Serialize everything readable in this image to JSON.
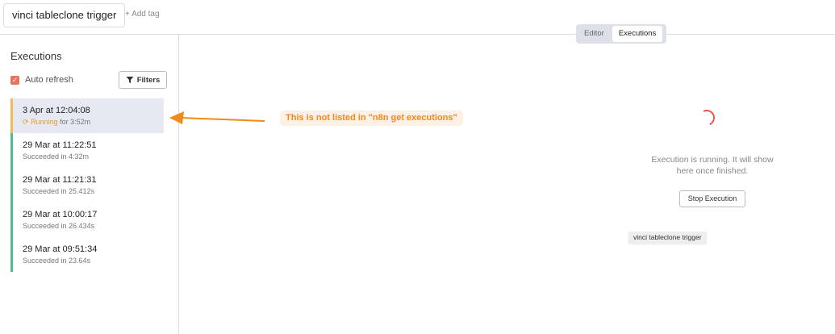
{
  "header": {
    "workflow_name": "vinci tableclone trigger",
    "add_tag": "+ Add tag",
    "tabs": [
      {
        "label": "Editor",
        "active": false
      },
      {
        "label": "Executions",
        "active": true
      }
    ]
  },
  "sidebar": {
    "title": "Executions",
    "auto_refresh": {
      "label": "Auto refresh",
      "checked": true
    },
    "filters_label": "Filters",
    "executions": [
      {
        "date": "3 Apr at 12:04:08",
        "status_word": "Running",
        "status_rest": " for 3:52m",
        "state": "running"
      },
      {
        "date": "29 Mar at 11:22:51",
        "status": "Succeeded in 4:32m",
        "state": "success"
      },
      {
        "date": "29 Mar at 11:21:31",
        "status": "Succeeded in 25.412s",
        "state": "success"
      },
      {
        "date": "29 Mar at 10:00:17",
        "status": "Succeeded in 26.434s",
        "state": "success"
      },
      {
        "date": "29 Mar at 09:51:34",
        "status": "Succeeded in 23.64s",
        "state": "success"
      }
    ]
  },
  "main": {
    "running_message": "Execution is running. It will show here once finished.",
    "stop_label": "Stop Execution",
    "node_label": "vinci tableclone trigger"
  },
  "annotation": {
    "text": "This is not listed in \"n8n get executions\""
  },
  "colors": {
    "accent": "#e8735b",
    "running": "#f5b85b",
    "success": "#4fc08d",
    "annotation": "#f08a1c"
  }
}
